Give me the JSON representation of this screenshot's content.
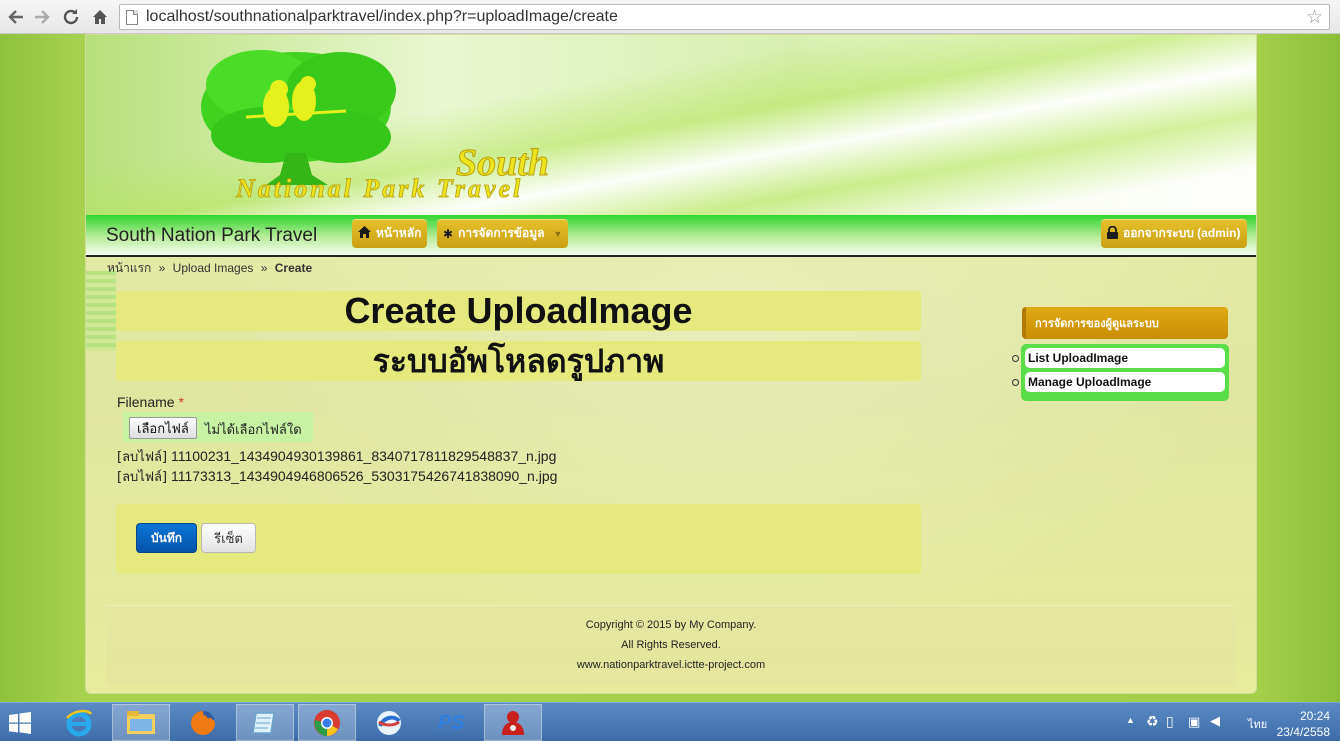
{
  "browser": {
    "url": "localhost/southnationalparktravel/index.php?r=uploadImage/create",
    "back_icon": "back-arrow-icon",
    "forward_icon": "forward-arrow-icon",
    "reload_icon": "reload-icon",
    "home_icon": "home-icon",
    "bookmark_icon": "star-icon"
  },
  "header": {
    "logo_text_line1": "South",
    "logo_text_line2": "National Park Travel"
  },
  "navbar": {
    "brand": "South Nation Park Travel",
    "home_label": "หน้าหลัก",
    "data_menu_label": "การจัดการข้อมูล",
    "logout_label": "ออกจากระบบ (admin)"
  },
  "breadcrumb": {
    "home": "หน้าแรก",
    "separator": "»",
    "parent": "Upload Images",
    "current": "Create"
  },
  "page": {
    "title": "Create UploadImage",
    "subtitle": "ระบบอัพโหลดรูปภาพ"
  },
  "form": {
    "filename_label": "Filename",
    "required_mark": "*",
    "choose_file_label": "เลือกไฟล์",
    "no_file_label": "ไม่ได้เลือกไฟล์ใด",
    "delete_label": "[ลบไฟล์]",
    "files": [
      "11100231_1434904930139861_8340717811829548837_n.jpg",
      "11173313_1434904946806526_5303175426741838090_n.jpg"
    ],
    "save_label": "บันทึก",
    "reset_label": "รีเซ็ต"
  },
  "sidebar": {
    "title": "การจัดการของผู้ดูแลระบบ",
    "items": [
      {
        "label": "List UploadImage"
      },
      {
        "label": "Manage UploadImage"
      }
    ]
  },
  "footer": {
    "copyright": "Copyright © 2015 by My Company.",
    "rights": "All Rights Reserved.",
    "website": "www.nationparktravel.ictte-project.com"
  },
  "taskbar": {
    "language": "ไทย",
    "time": "20:24",
    "date": "23/4/2558"
  },
  "colors": {
    "navbar_green": "#2fd52c",
    "nav_pill_gold": "#d9b01f",
    "content_panel": "#e6ea7e",
    "save_button_blue": "#0a6acb",
    "sidebar_menu_green": "#59dd48",
    "required_red": "#d03a2c"
  }
}
